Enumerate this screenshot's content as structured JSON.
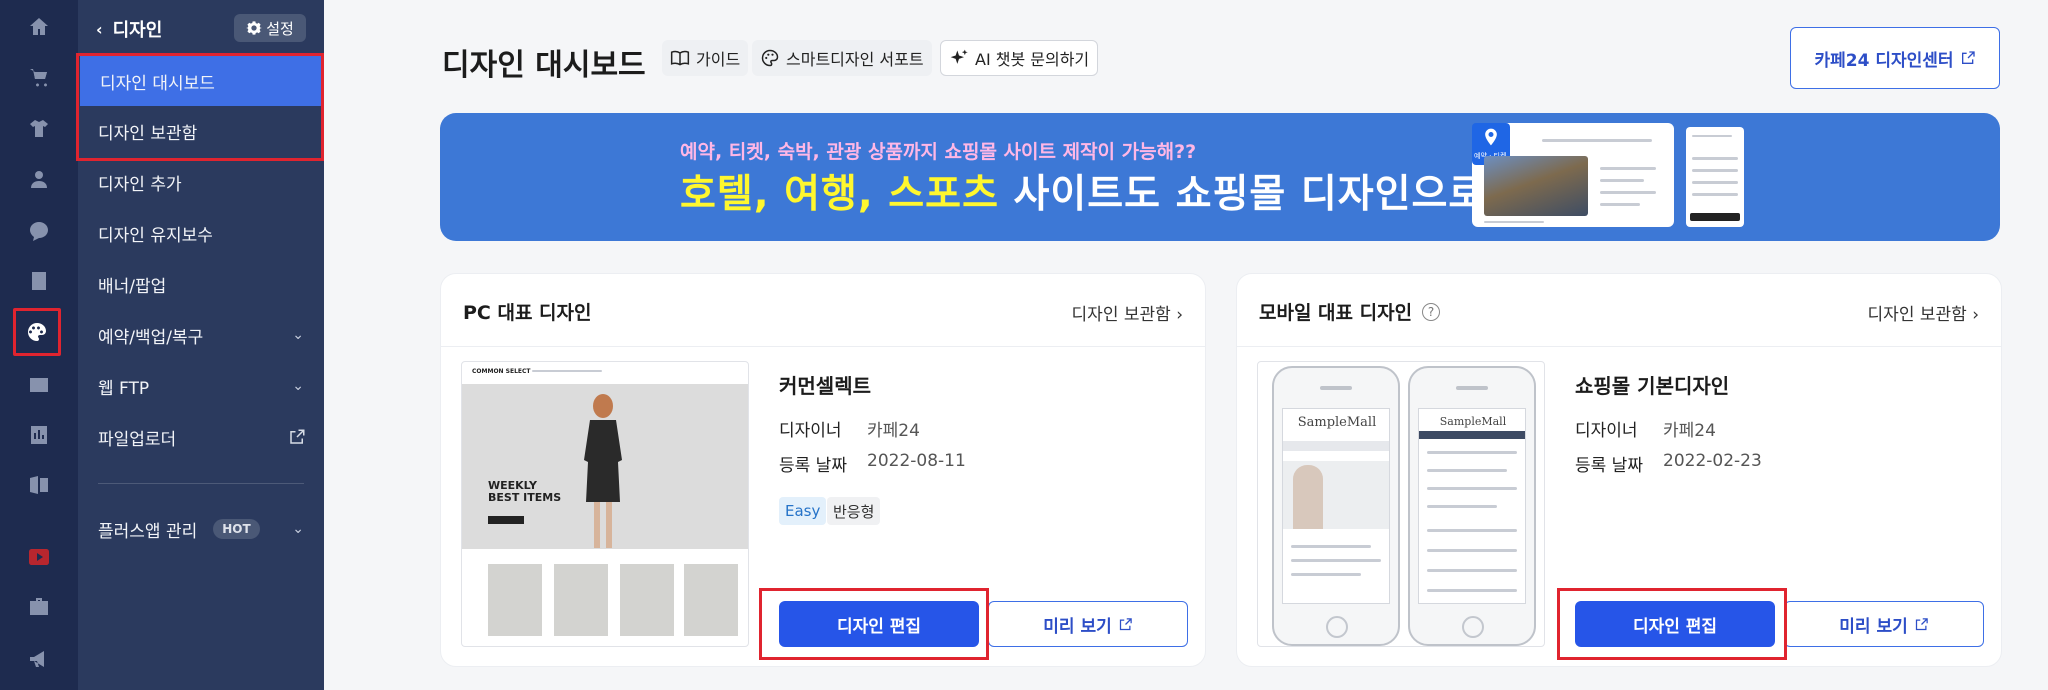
{
  "rail": {
    "items": [
      "home-icon",
      "cart-icon",
      "shirt-icon",
      "user-icon",
      "chat-icon",
      "board-icon",
      "palette-icon",
      "promotion-icon",
      "stats-icon",
      "app-icon",
      "youtube-icon",
      "store-icon",
      "megaphone-icon"
    ],
    "active": "palette-icon"
  },
  "submenu": {
    "back_label": "디자인",
    "settings_label": "설정",
    "items": [
      {
        "label": "디자인 대시보드",
        "active": true
      },
      {
        "label": "디자인 보관함"
      },
      {
        "label": "디자인 추가"
      },
      {
        "label": "디자인 유지보수"
      },
      {
        "label": "배너/팝업"
      },
      {
        "label": "예약/백업/복구",
        "chevron": true
      },
      {
        "label": "웹 FTP",
        "chevron": true
      },
      {
        "label": "파일업로더",
        "external": true
      }
    ],
    "plus_app": {
      "label": "플러스앱 관리",
      "badge": "HOT"
    }
  },
  "header": {
    "title": "디자인 대시보드",
    "chips": [
      "가이드",
      "스마트디자인 서포트",
      "AI 챗봇 문의하기"
    ],
    "design_center_label": "카페24 디자인센터"
  },
  "banner": {
    "subtitle": "예약, 티켓, 숙박, 관광 상품까지 쇼핑몰 사이트 제작이 가능해??",
    "title_highlight": "호텔, 여행, 스포츠",
    "title_rest": " 사이트도 쇼핑몰 디자인으로",
    "pin_label": "예약 · 티켓",
    "colors": {
      "background": "#3d78d6",
      "subtitle": "#ffb7e6",
      "highlight": "#fff72e"
    }
  },
  "pc_card": {
    "title": "PC 대표 디자인",
    "link": "디자인 보관함 ›",
    "design_name": "커먼셀렉트",
    "designer_key": "디자이너",
    "designer_val": "카페24",
    "date_key": "등록 날짜",
    "date_val": "2022-08-11",
    "badges": [
      "Easy",
      "반응형"
    ],
    "thumb_text": "WEEKLY\nBEST ITEMS",
    "thumb_logo": "COMMON SELECT",
    "edit_label": "디자인 편집",
    "preview_label": "미리 보기"
  },
  "mobile_card": {
    "title": "모바일 대표 디자인",
    "help": "?",
    "link": "디자인 보관함 ›",
    "design_name": "쇼핑몰 기본디자인",
    "designer_key": "디자이너",
    "designer_val": "카페24",
    "date_key": "등록 날짜",
    "date_val": "2022-02-23",
    "thumb_logo": "SampleMall",
    "edit_label": "디자인 편집",
    "preview_label": "미리 보기"
  }
}
